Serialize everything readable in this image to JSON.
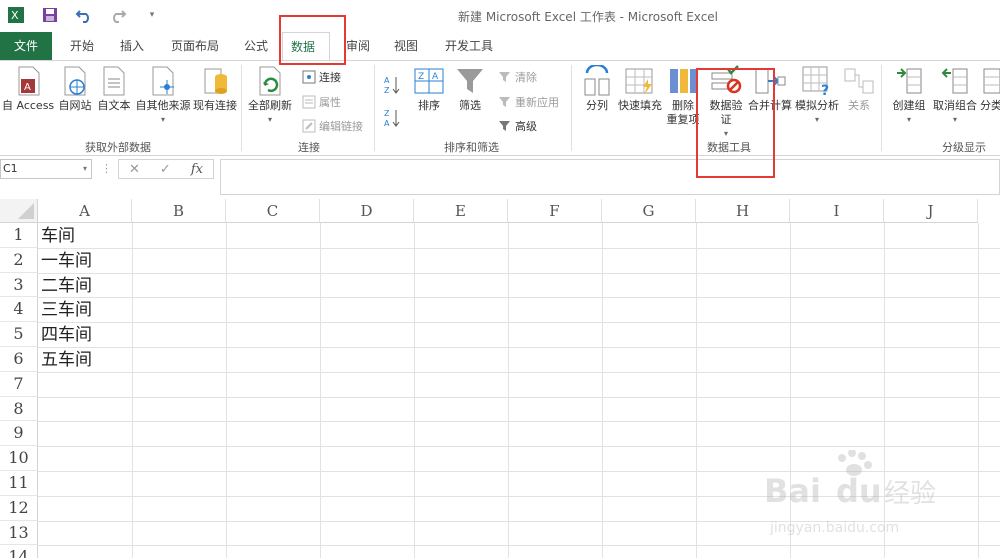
{
  "window": {
    "title": "新建 Microsoft Excel 工作表 - Microsoft Excel"
  },
  "qat": {
    "items": [
      "excel-logo",
      "save",
      "undo",
      "redo",
      "customize"
    ]
  },
  "tabs": {
    "file": "文件",
    "items": [
      "开始",
      "插入",
      "页面布局",
      "公式",
      "数据",
      "审阅",
      "视图",
      "开发工具"
    ],
    "active": "数据"
  },
  "ribbon": {
    "external": {
      "label": "获取外部数据",
      "access": "自 Access",
      "web": "自网站",
      "text": "自文本",
      "other": "自其他来源",
      "existing": "现有连接"
    },
    "connections": {
      "label": "连接",
      "refresh": "全部刷新",
      "connect": "连接",
      "props": "属性",
      "edit": "编辑链接"
    },
    "sort": {
      "label": "排序和筛选",
      "sort": "排序",
      "filter": "筛选",
      "clear": "清除",
      "reapply": "重新应用",
      "advanced": "高级"
    },
    "tools": {
      "label": "数据工具",
      "split": "分列",
      "flash": "快速填充",
      "dedupe_a": "删除",
      "dedupe_b": "重复项",
      "validate_a": "数据验",
      "validate_b": "证",
      "consolidate": "合并计算",
      "whatif": "模拟分析",
      "relations": "关系"
    },
    "outline": {
      "label": "分级显示",
      "group": "创建组",
      "ungroup": "取消组合",
      "subtotal": "分类"
    }
  },
  "formula_bar": {
    "name_box": "C1",
    "fx": "fx"
  },
  "sheet": {
    "columns": [
      "A",
      "B",
      "C",
      "D",
      "E",
      "F",
      "G",
      "H",
      "I",
      "J"
    ],
    "rows": [
      "1",
      "2",
      "3",
      "4",
      "5",
      "6",
      "7",
      "8",
      "9",
      "10",
      "11",
      "12",
      "13",
      "14"
    ],
    "column_a": [
      "车间",
      "一车间",
      "二车间",
      "三车间",
      "四车间",
      "五车间"
    ]
  },
  "watermark": {
    "brand": "Bai",
    "brand2": "du",
    "cn": "经验",
    "url": "jingyan.baidu.com"
  },
  "colors": {
    "accent": "#217346",
    "highlight": "#e53935"
  }
}
